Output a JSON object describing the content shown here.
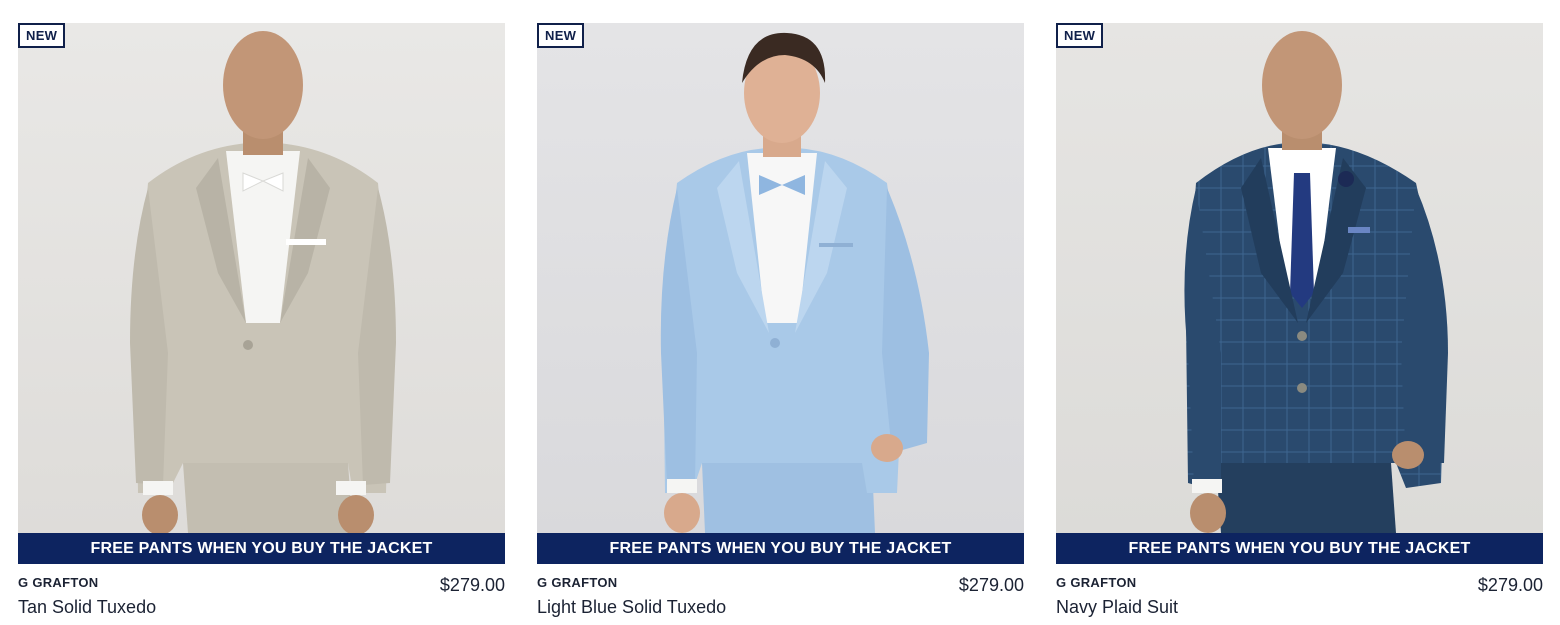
{
  "products": [
    {
      "badge": "NEW",
      "promo": "FREE PANTS WHEN YOU BUY THE JACKET",
      "brand": "G GRAFTON",
      "name": "Tan Solid Tuxedo",
      "price": "$279.00",
      "suit_color": "#c9c4b7",
      "accessory_color": "#ffffff"
    },
    {
      "badge": "NEW",
      "promo": "FREE PANTS WHEN YOU BUY THE JACKET",
      "brand": "G GRAFTON",
      "name": "Light Blue Solid Tuxedo",
      "price": "$279.00",
      "suit_color": "#a9c9e8",
      "accessory_color": "#8fb6e0"
    },
    {
      "badge": "NEW",
      "promo": "FREE PANTS WHEN YOU BUY THE JACKET",
      "brand": "G GRAFTON",
      "name": "Navy Plaid Suit",
      "price": "$279.00",
      "suit_color": "#2a4a6e",
      "accessory_color": "#233a80"
    }
  ],
  "colors": {
    "promo_bg": "#0d2460",
    "badge_border": "#10204a",
    "text": "#1b2233"
  }
}
